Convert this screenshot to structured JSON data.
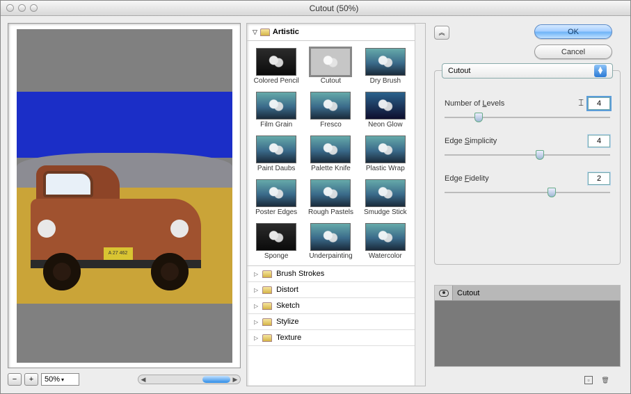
{
  "window": {
    "title": "Cutout (50%)"
  },
  "preview": {
    "zoom": "50%",
    "plate": "A 27 462"
  },
  "gallery": {
    "expanded_category": "Artistic",
    "filters": [
      {
        "label": "Colored Pencil",
        "style": "dark"
      },
      {
        "label": "Cutout",
        "style": "",
        "selected": true
      },
      {
        "label": "Dry Brush",
        "style": ""
      },
      {
        "label": "Film Grain",
        "style": ""
      },
      {
        "label": "Fresco",
        "style": ""
      },
      {
        "label": "Neon Glow",
        "style": "neon"
      },
      {
        "label": "Paint Daubs",
        "style": ""
      },
      {
        "label": "Palette Knife",
        "style": ""
      },
      {
        "label": "Plastic Wrap",
        "style": ""
      },
      {
        "label": "Poster Edges",
        "style": ""
      },
      {
        "label": "Rough Pastels",
        "style": ""
      },
      {
        "label": "Smudge Stick",
        "style": ""
      },
      {
        "label": "Sponge",
        "style": "dark"
      },
      {
        "label": "Underpainting",
        "style": ""
      },
      {
        "label": "Watercolor",
        "style": ""
      }
    ],
    "categories": [
      "Brush Strokes",
      "Distort",
      "Sketch",
      "Stylize",
      "Texture"
    ]
  },
  "buttons": {
    "ok": "OK",
    "cancel": "Cancel"
  },
  "settings": {
    "selected_filter": "Cutout",
    "params": {
      "levels": {
        "label_pre": "Number of ",
        "label_u": "L",
        "label_post": "evels",
        "value": "4",
        "pos": 18
      },
      "simplicity": {
        "label_pre": "Edge ",
        "label_u": "S",
        "label_post": "implicity",
        "value": "4",
        "pos": 55
      },
      "fidelity": {
        "label_pre": "Edge ",
        "label_u": "F",
        "label_post": "idelity",
        "value": "2",
        "pos": 62
      }
    }
  },
  "layers": {
    "name": "Cutout"
  }
}
